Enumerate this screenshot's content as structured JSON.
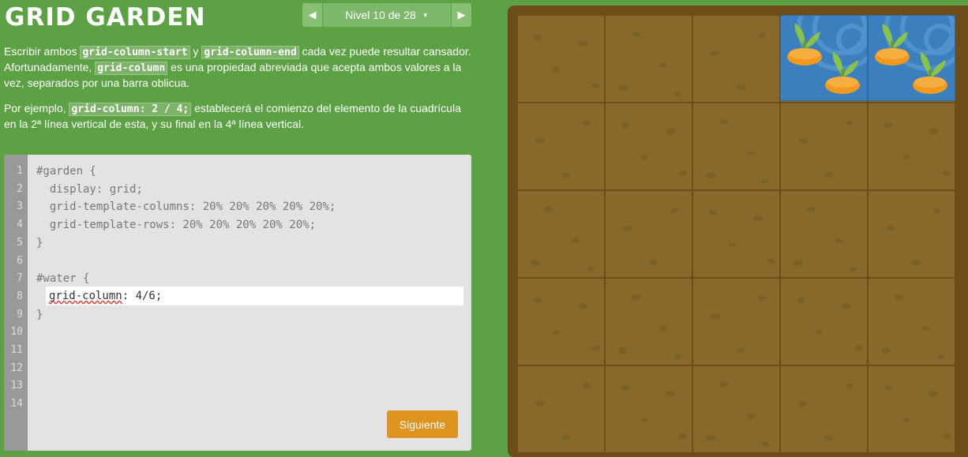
{
  "header": {
    "title": "GRID GARDEN",
    "level_label": "Nivel 10 de 28"
  },
  "instructions": {
    "p1_a": "Escribir ambos ",
    "p1_code1": "grid-column-start",
    "p1_b": " y ",
    "p1_code2": "grid-column-end",
    "p1_c": " cada vez puede resultar cansador. Afortunadamente, ",
    "p1_code3": "grid-column",
    "p1_d": " es una propiedad abreviada que acepta ambos valores a la vez, separados por una barra oblicua.",
    "p2_a": "Por ejemplo, ",
    "p2_code": "grid-column: 2 / 4;",
    "p2_b": " establecerá el comienzo del elemento de la cuadrícula en la 2ª línea vertical de esta, y su final en la 4ª línea vertical."
  },
  "editor": {
    "line_numbers": [
      "1",
      "2",
      "3",
      "4",
      "5",
      "6",
      "7",
      "8",
      "9",
      "10",
      "11",
      "12",
      "13",
      "14"
    ],
    "code_lines": [
      "#garden {",
      "  display: grid;",
      "  grid-template-columns: 20% 20% 20% 20% 20%;",
      "  grid-template-rows: 20% 20% 20% 20% 20%;",
      "}",
      "",
      "#water {",
      "",
      "}"
    ],
    "answer_value": "grid-column: 4/6;",
    "next_button": "Siguiente"
  },
  "garden": {
    "columns": 5,
    "rows": 5,
    "water_column": "4/6",
    "colors": {
      "background": "#5ca144",
      "soil": "#87692b",
      "frame": "#6c4c17",
      "water": "#3b7fbe",
      "carrot": "#f39a1e",
      "leaf": "#8bc34a",
      "button": "#e0931f"
    }
  }
}
